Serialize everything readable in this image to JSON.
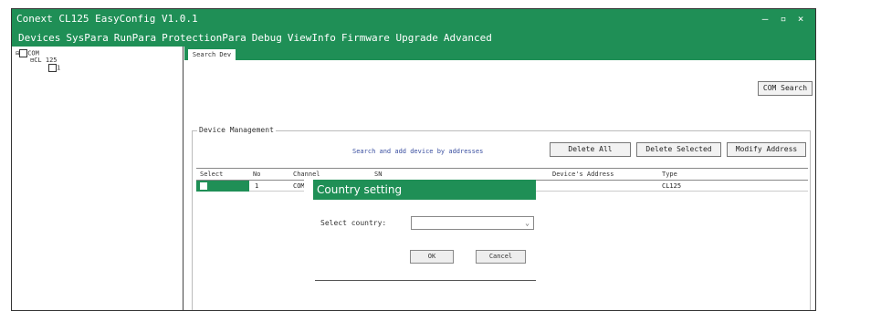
{
  "window": {
    "title": "Conext CL125 EasyConfig V1.0.1",
    "controls": {
      "minimize": "–",
      "maximize": "▫",
      "close": "×"
    }
  },
  "menu": [
    "Devices",
    "SysPara",
    "RunPara",
    "ProtectionPara",
    "Debug",
    "ViewInfo",
    "Firmware Upgrade",
    "Advanced"
  ],
  "tree": {
    "root": "COM",
    "child": "CL 125",
    "leaf": "1"
  },
  "tabs": {
    "active": "Search Dev"
  },
  "toolbar": {
    "com_search": "COM Search"
  },
  "device_management": {
    "label": "Device Management",
    "link": "Search and add device by addresses",
    "delete_all": "Delete All",
    "delete_selected": "Delete Selected",
    "modify_address": "Modify Address",
    "columns": [
      "Select",
      "No",
      "Channel",
      "SN",
      "Device's Address",
      "Type"
    ],
    "rows": [
      {
        "no": "1",
        "channel": "COM",
        "sn": "",
        "address": "",
        "type": "CL125"
      }
    ]
  },
  "dialog": {
    "title": "Country setting",
    "select_label": "Select country:",
    "selected_value": "",
    "ok": "OK",
    "cancel": "Cancel"
  },
  "colors": {
    "accent": "#1f8f56"
  }
}
